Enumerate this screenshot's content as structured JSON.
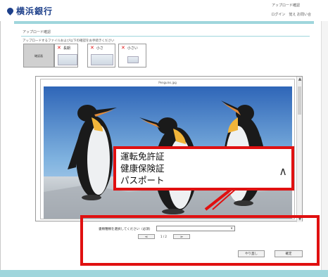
{
  "header": {
    "bank_name": "横浜銀行",
    "right_line1": "アップロード確認",
    "right_line2": "ログイン　覚え  お問い合"
  },
  "page": {
    "title": "アップロード確認",
    "instruction": "アップロードするファイルおよび以下の確認をお手続きください"
  },
  "tabs": [
    {
      "label": "確認画",
      "state": "active"
    },
    {
      "label": "長期",
      "mark": "✕"
    },
    {
      "label": "小さ",
      "mark": "✕"
    },
    {
      "label": "小さい",
      "mark": "✕"
    }
  ],
  "viewer": {
    "file_name": "Penguins.jpg"
  },
  "callout": {
    "options": [
      "運転免許証",
      "健康保険証",
      "パスポート"
    ],
    "chevron": "∧"
  },
  "doc_select": {
    "label": "書類種類を選択してください（必須）",
    "value": "∨"
  },
  "pager": {
    "prev": "≪",
    "text": "1 / 2",
    "next": "≫"
  },
  "actions": {
    "redo": "やり直し",
    "confirm": "確定"
  },
  "colors": {
    "accent": "#9fd6dc",
    "highlight": "#e01010",
    "brand": "#1c3f8a"
  }
}
